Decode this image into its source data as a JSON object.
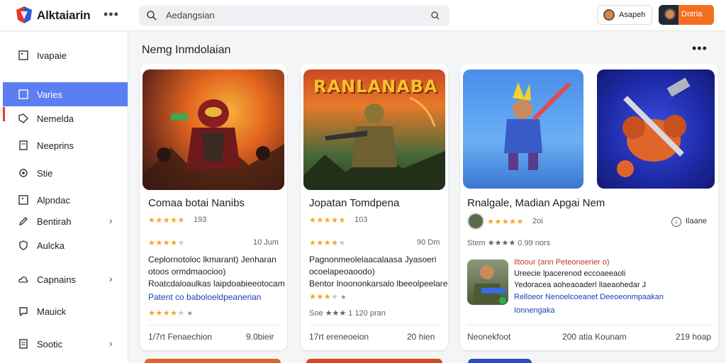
{
  "app": {
    "title": "Alktaiarin"
  },
  "search": {
    "value": "Aedangsian"
  },
  "header": {
    "user_label": "Asapeh",
    "primary_label": "Dotria"
  },
  "sidebar": {
    "items": [
      {
        "label": "Ivapaie",
        "icon": "square-icon"
      },
      {
        "label": "Varies",
        "icon": "square-icon",
        "active": true
      },
      {
        "label": "Nemelda",
        "icon": "tag-icon"
      },
      {
        "label": "Neeprins",
        "icon": "document-icon"
      },
      {
        "label": "Stie",
        "icon": "gear-icon"
      },
      {
        "label": "Alpndac",
        "icon": "square-icon"
      },
      {
        "label": "Bentirah",
        "icon": "pen-icon",
        "chevron": true
      },
      {
        "label": "Aulcka",
        "icon": "shield-icon"
      },
      {
        "label": "Capnains",
        "icon": "cloud-icon",
        "chevron": true
      },
      {
        "label": "Mauick",
        "icon": "chat-icon"
      },
      {
        "label": "Sootic",
        "icon": "document-icon",
        "chevron": true
      }
    ]
  },
  "main": {
    "title": "Nemg Inmdolaian",
    "more": "•••",
    "cards": [
      {
        "name": "Comaa botai Nanibs",
        "rating": 5,
        "rating_count": "193",
        "rating2": 4,
        "meta": "10 Jum",
        "desc": [
          "Ceplornotoloc lkmarant) Jenharan",
          "otoos ormdmaocioo)",
          "Roatcdaloaulkas laipdoabieeotocam"
        ],
        "link": "Patent co baboloeldpeanerian",
        "rating3": 4,
        "foot_left": "1/7rt Fenaechion",
        "foot_right": "9.0bieir"
      },
      {
        "name": "Jopatan Tomdpena",
        "banner": "RANLANABA",
        "rating": 5,
        "rating_count": "103",
        "rating2": 4,
        "meta": "90 Dm",
        "desc": [
          "Pagnonmeolelaacalaasa Jyasoeri",
          "ocoelapeoaoodo)",
          "Bentor lnoononkarsalo lbeeolpeelare"
        ],
        "link": "",
        "rating3": 3,
        "meta3": "Soe ★★★ 1 120 pran",
        "foot_left": "17rt ereneoeion",
        "foot_right": "20 hien"
      },
      {
        "name": "Rnalgale, Madian Apgai Nem",
        "rating": 5,
        "rating_count": "2oi",
        "info": "Ilaane",
        "meta2": "Stem ★★★★ 0.99 nors",
        "review_title": "Iltoour (ann Peteoneerier o)",
        "review_lines": [
          "Ureecie lpacerenod eccoaeeaoli",
          "Yedoracea aoheaoaderl Ilaeaohedar J"
        ],
        "review_link": "Relloeor Nenoelcoeanet Deeoeonmpaakan",
        "review_tag": "Ionnengaka",
        "foot_left": "Neonekfoot",
        "foot_mid": "200 atia Kounam",
        "foot_right": "219 hoap"
      }
    ]
  },
  "colors": {
    "accent": "#5b7ff2",
    "primary_button": "#f36f1f",
    "link": "#1a3fb8",
    "star": "#f5a623"
  }
}
